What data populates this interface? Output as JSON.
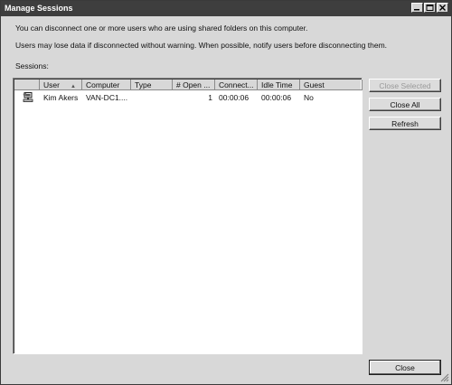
{
  "window": {
    "title": "Manage Sessions",
    "minimize_icon": "minimize-icon",
    "maximize_icon": "maximize-icon",
    "close_icon": "close-icon"
  },
  "messages": {
    "line1": "You can disconnect one or more users who are using shared folders on this computer.",
    "line2": "Users may lose data if disconnected without warning. When possible, notify users before disconnecting them."
  },
  "sessions_label": "Sessions:",
  "table": {
    "columns": [
      "User",
      "Computer",
      "Type",
      "# Open ...",
      "Connect...",
      "Idle Time",
      "Guest"
    ],
    "sort_column": "User",
    "rows": [
      {
        "icon": "user-session-icon",
        "user": "Kim Akers",
        "computer": "VAN-DC1....",
        "type": "",
        "open": "1",
        "connect": "00:00:06",
        "idle": "00:00:06",
        "guest": "No"
      }
    ]
  },
  "buttons": {
    "close_selected": "Close Selected",
    "close_all": "Close All",
    "refresh": "Refresh",
    "close": "Close"
  }
}
